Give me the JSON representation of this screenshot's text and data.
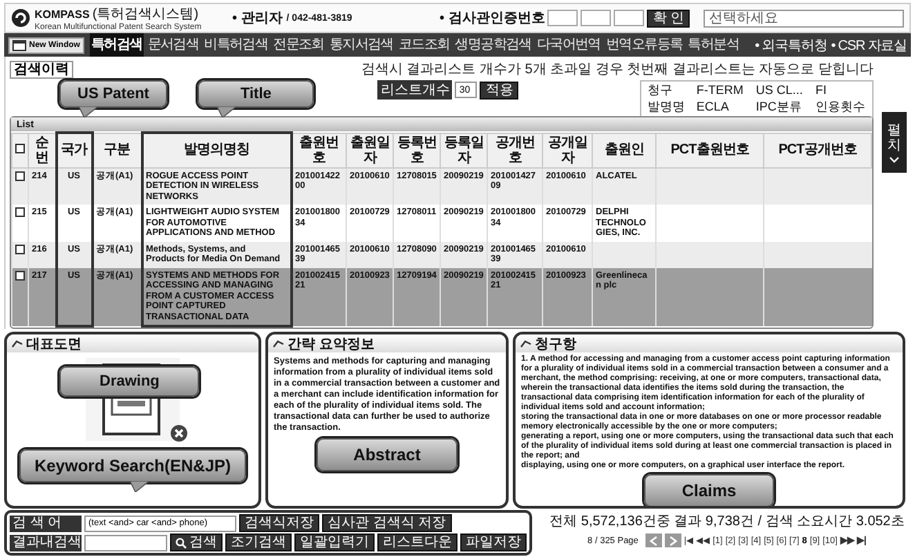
{
  "header": {
    "logo": "KOMPASS",
    "logo_suffix": "(특허검색시스템)",
    "subtitle": "Korean Multifunctional Patent Search System",
    "contact_label": "• 관리자",
    "contact_value": "/ 042-481-3819",
    "auth_label": "• 검사관인증번호",
    "confirm_button": "확 인",
    "select_placeholder": "선택하세요"
  },
  "nav": {
    "new_window": "New Window",
    "items": [
      {
        "label": "특허검색",
        "selected": true
      },
      {
        "label": "문서검색",
        "selected": false
      },
      {
        "label": "비특허검색",
        "selected": false
      },
      {
        "label": "전문조회",
        "selected": false
      },
      {
        "label": "통지서검색",
        "selected": false
      },
      {
        "label": "코드조회",
        "selected": false
      },
      {
        "label": "생명공학검색",
        "selected": false
      },
      {
        "label": "다국어번역",
        "selected": false
      },
      {
        "label": "번역오류등록",
        "selected": false
      },
      {
        "label": "특허분석",
        "selected": false
      }
    ],
    "links": [
      "• 외국특허청",
      "• CSR 자료실"
    ]
  },
  "history_tab": {
    "label": "검색이력",
    "selected": true
  },
  "notice": "검색시 결과리스트 개수가 5개 초과일 경우 첫번째 결과리스트는 자동으로 닫힙니다",
  "annotations": {
    "country": "US Patent",
    "title": "Title",
    "drawing": "Drawing",
    "abstract": "Abstract",
    "claims": "Claims",
    "keyword": "Keyword Search(EN&JP)"
  },
  "list_count": {
    "label": "리스트개수",
    "value": "30",
    "apply": "적용"
  },
  "field_options": [
    "청구",
    "F-TERM",
    "US CL...",
    "FI",
    "발명명",
    "ECLA",
    "IPC분류",
    "인용횟수"
  ],
  "table": {
    "title": "List",
    "all_checked": false,
    "columns": [
      "순번",
      "국가",
      "구분",
      "발명의명칭",
      "출원번호",
      "출원일자",
      "등록번호",
      "등록일자",
      "공개번호",
      "공개일자",
      "출원인",
      "PCT출원번호",
      "PCT공개번호"
    ],
    "rows": [
      {
        "checked": false,
        "selected": false,
        "cells": [
          "214",
          "US",
          "공개(A1)",
          "ROGUE ACCESS POINT DETECTION IN WIRELESS NETWORKS",
          "20100142200",
          "20100610",
          "12708015",
          "20090219",
          "20100142709",
          "20100610",
          "ALCATEL",
          "",
          ""
        ]
      },
      {
        "checked": false,
        "selected": false,
        "cells": [
          "215",
          "US",
          "공개(A1)",
          "LIGHTWEIGHT AUDIO SYSTEM FOR AUTOMOTIVE APPLICATIONS AND METHOD",
          "20100180034",
          "20100729",
          "12708011",
          "20090219",
          "20100180034",
          "20100729",
          "DELPHI TECHNOLOGIES, INC.",
          "",
          ""
        ]
      },
      {
        "checked": false,
        "selected": false,
        "cells": [
          "216",
          "US",
          "공개(A1)",
          "Methods, Systems, and Products for Media On Demand",
          "20100146539",
          "20100610",
          "12708090",
          "20090219",
          "20100146539",
          "20100610",
          "",
          "",
          ""
        ]
      },
      {
        "checked": false,
        "selected": true,
        "cells": [
          "217",
          "US",
          "공개(A1)",
          "SYSTEMS AND METHODS FOR ACCESSING AND MANAGING FROM A CUSTOMER ACCESS POINT CAPTURED TRANSACTIONAL DATA",
          "20100241521",
          "20100923",
          "12709194",
          "20090219",
          "20100241521",
          "20100923",
          "Greenlinecan plc",
          "",
          ""
        ]
      }
    ]
  },
  "side_tab": "펼치",
  "drawing_panel": {
    "title": "대표도면"
  },
  "abstract_panel": {
    "title": "간략 요약정보",
    "text": "Systems and methods for capturing and managing information from a plurality of individual items sold in a commercial transaction between a customer and a merchant can include identification information for each of the plurality of individual items sold. The transactional data can further be used to authorize the transaction."
  },
  "claims_panel": {
    "title": "청구항",
    "paragraphs": [
      "1. A method for accessing and managing from a customer access point capturing information for a plurality of individual items sold in a commercial transaction between a consumer and a merchant, the method comprising: receiving, at one or more computers, transactional data, wherein the transactional data identifies the items sold during the transaction, the transactional data comprising item identification information for each of the plurality of individual items sold and account information;",
      "storing the transactional data in one or more databases on one or more processor readable memory electronically accessible by the one or more computers;",
      "generating a report, using one or more computers, using the transactional data such that each of the plurality of individual items sold during at least one commercial transaction is placed in the report; and",
      "displaying, using one or more computers, on a graphical user interface the report."
    ]
  },
  "search": {
    "label": "검 색 어",
    "value": "(text <and> car <and> phone)",
    "buttons": [
      "검색식저장",
      "심사관 검색식 저장"
    ],
    "refine_label": "결과내검색",
    "search_button": "검색",
    "tools": [
      "조기검색",
      "일괄입력기",
      "리스트다운",
      "파일저장"
    ]
  },
  "status": "전체 5,572,136건중 결과 9,738건 / 검색 소요시간 3.052초",
  "pager": {
    "page": "8 / 325 Page",
    "first": "|◀",
    "prev": "◀◀",
    "pages": [
      {
        "label": "[1]",
        "selected": false
      },
      {
        "label": "[2]",
        "selected": false
      },
      {
        "label": "[3]",
        "selected": false
      },
      {
        "label": "[4]",
        "selected": false
      },
      {
        "label": "[5]",
        "selected": false
      },
      {
        "label": "[6]",
        "selected": false
      },
      {
        "label": "[7]",
        "selected": false
      },
      {
        "label": "8",
        "selected": true
      },
      {
        "label": "[9]",
        "selected": false
      },
      {
        "label": "[10]",
        "selected": false
      }
    ],
    "next": "▶▶",
    "last": "▶|"
  }
}
